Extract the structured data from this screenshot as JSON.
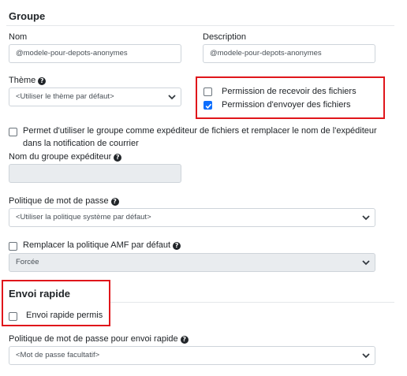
{
  "groupe": {
    "section_title": "Groupe",
    "nom_label": "Nom",
    "nom_value": "@modele-pour-depots-anonymes",
    "description_label": "Description",
    "description_value": "@modele-pour-depots-anonymes",
    "theme_label": "Thème",
    "theme_value": "<Utiliser le thème par défaut>",
    "permission_receive_label": "Permission de recevoir des fichiers",
    "permission_receive_checked": false,
    "permission_send_label": "Permission d'envoyer des fichiers",
    "permission_send_checked": true,
    "sender_line1": "Permet d'utiliser le groupe comme expéditeur de fichiers et remplacer le nom de l'expéditeur",
    "sender_line2": "dans la notification de courrier",
    "sender_name_label": "Nom du groupe expéditeur",
    "sender_name_value": "",
    "password_policy_label": "Politique de mot de passe",
    "password_policy_value": "<Utiliser la politique système par défaut>",
    "amf_label": "Remplacer la politique AMF par défaut",
    "amf_value": "Forcée"
  },
  "envoi_rapide": {
    "section_title": "Envoi rapide",
    "allowed_label": "Envoi rapide permis",
    "allowed_checked": false,
    "password_policy_label": "Politique de mot de passe pour envoi rapide",
    "password_policy_value": "<Mot de passe facultatif>"
  },
  "colors": {
    "accent": "#0d6efd",
    "highlight": "#e0161b"
  }
}
